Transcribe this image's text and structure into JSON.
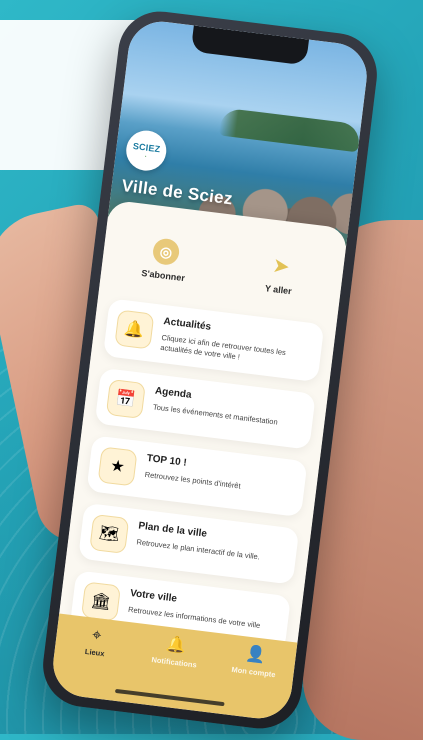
{
  "app": {
    "title": "Ville de Sciez",
    "logo_text": "SCIEZ"
  },
  "quick_actions": [
    {
      "label": "S'abonner",
      "icon": "location-pin-icon"
    },
    {
      "label": "Y aller",
      "icon": "arrow-icon"
    }
  ],
  "cards": [
    {
      "title": "Actualités",
      "description": "Cliquez ici afin de retrouver toutes les actualités de votre ville !",
      "icon": "bell-icon"
    },
    {
      "title": "Agenda",
      "description": "Tous les événements et manifestation",
      "icon": "calendar-icon"
    },
    {
      "title": "TOP 10 !",
      "description": "Retrouvez les points d'intérêt",
      "icon": "star-icon"
    },
    {
      "title": "Plan de la ville",
      "description": "Retrouvez le plan interactif de la ville.",
      "icon": "map-icon"
    },
    {
      "title": "Votre ville",
      "description": "Retrouvez les informations de votre ville",
      "icon": "city-icon"
    }
  ],
  "bottom_nav": [
    {
      "label": "Lieux",
      "icon": "pin-icon",
      "active": true
    },
    {
      "label": "Notifications",
      "icon": "bell-icon",
      "active": false
    },
    {
      "label": "Mon compte",
      "icon": "user-icon",
      "active": false
    }
  ],
  "colors": {
    "accent_gold": "#E8C56A",
    "background_teal": "#24A4B8"
  }
}
